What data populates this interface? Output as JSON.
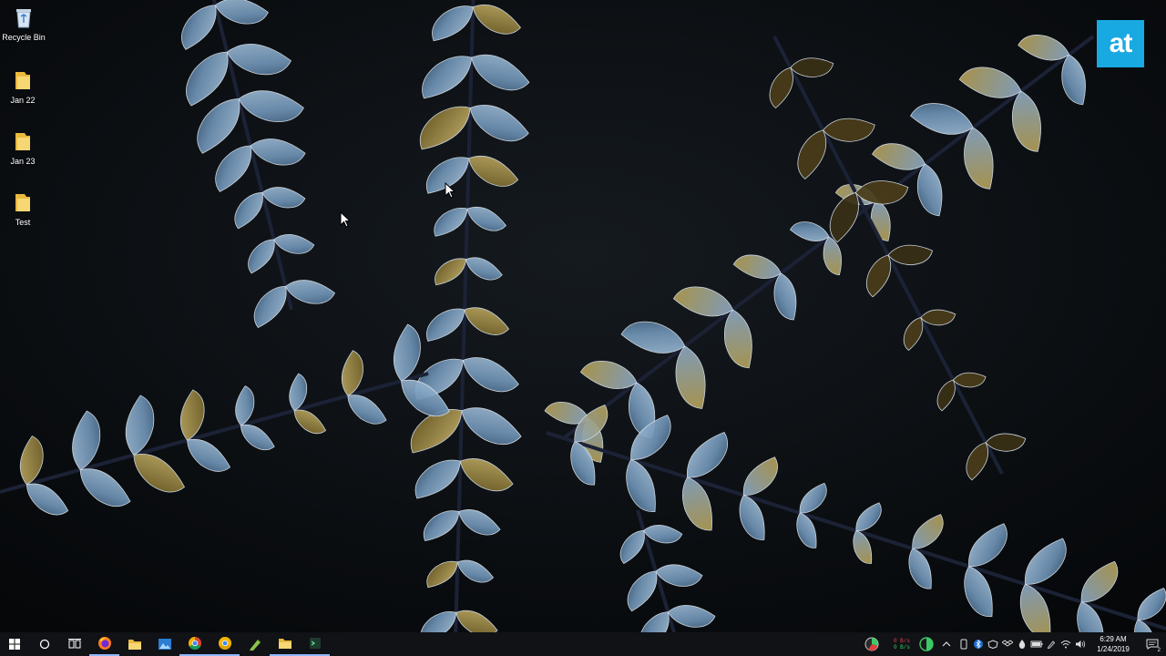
{
  "desktop": {
    "icons": [
      {
        "label": "Recycle Bin",
        "icon": "recycle-bin-icon"
      },
      {
        "label": "Jan 22",
        "icon": "folder-icon"
      },
      {
        "label": "Jan 23",
        "icon": "folder-icon"
      },
      {
        "label": "Test",
        "icon": "folder-icon"
      }
    ],
    "brand_logo": "at"
  },
  "colors": {
    "taskbar": "#101216",
    "logo": "#18a9e2",
    "folder": "#f2c94c",
    "frond_blue": "#7fa3c6",
    "frond_gold": "#a38f45"
  },
  "taskbar": {
    "buttons": [
      {
        "name": "start-button",
        "icon": "windows-logo-icon"
      },
      {
        "name": "cortana-search-button",
        "icon": "circle-icon"
      },
      {
        "name": "task-view-button",
        "icon": "task-view-icon"
      },
      {
        "name": "firefox-taskbar-button",
        "icon": "firefox-icon"
      },
      {
        "name": "file-explorer-taskbar-button",
        "icon": "folder-icon"
      },
      {
        "name": "photos-taskbar-button",
        "icon": "photos-icon"
      },
      {
        "name": "chrome-taskbar-button",
        "icon": "chrome-icon"
      },
      {
        "name": "chrome-canary-taskbar-button",
        "icon": "chrome-canary-icon"
      },
      {
        "name": "green-app-taskbar-button",
        "icon": "pencil-app-icon"
      },
      {
        "name": "explorer-window-taskbar-button",
        "icon": "folder-icon"
      },
      {
        "name": "terminal-taskbar-button",
        "icon": "terminal-icon"
      }
    ],
    "tray": {
      "upload_speed": "0 B/s",
      "download_speed": "0 B/s",
      "time": "6:29 AM",
      "date": "1/24/2019",
      "notification_count": "2"
    }
  }
}
